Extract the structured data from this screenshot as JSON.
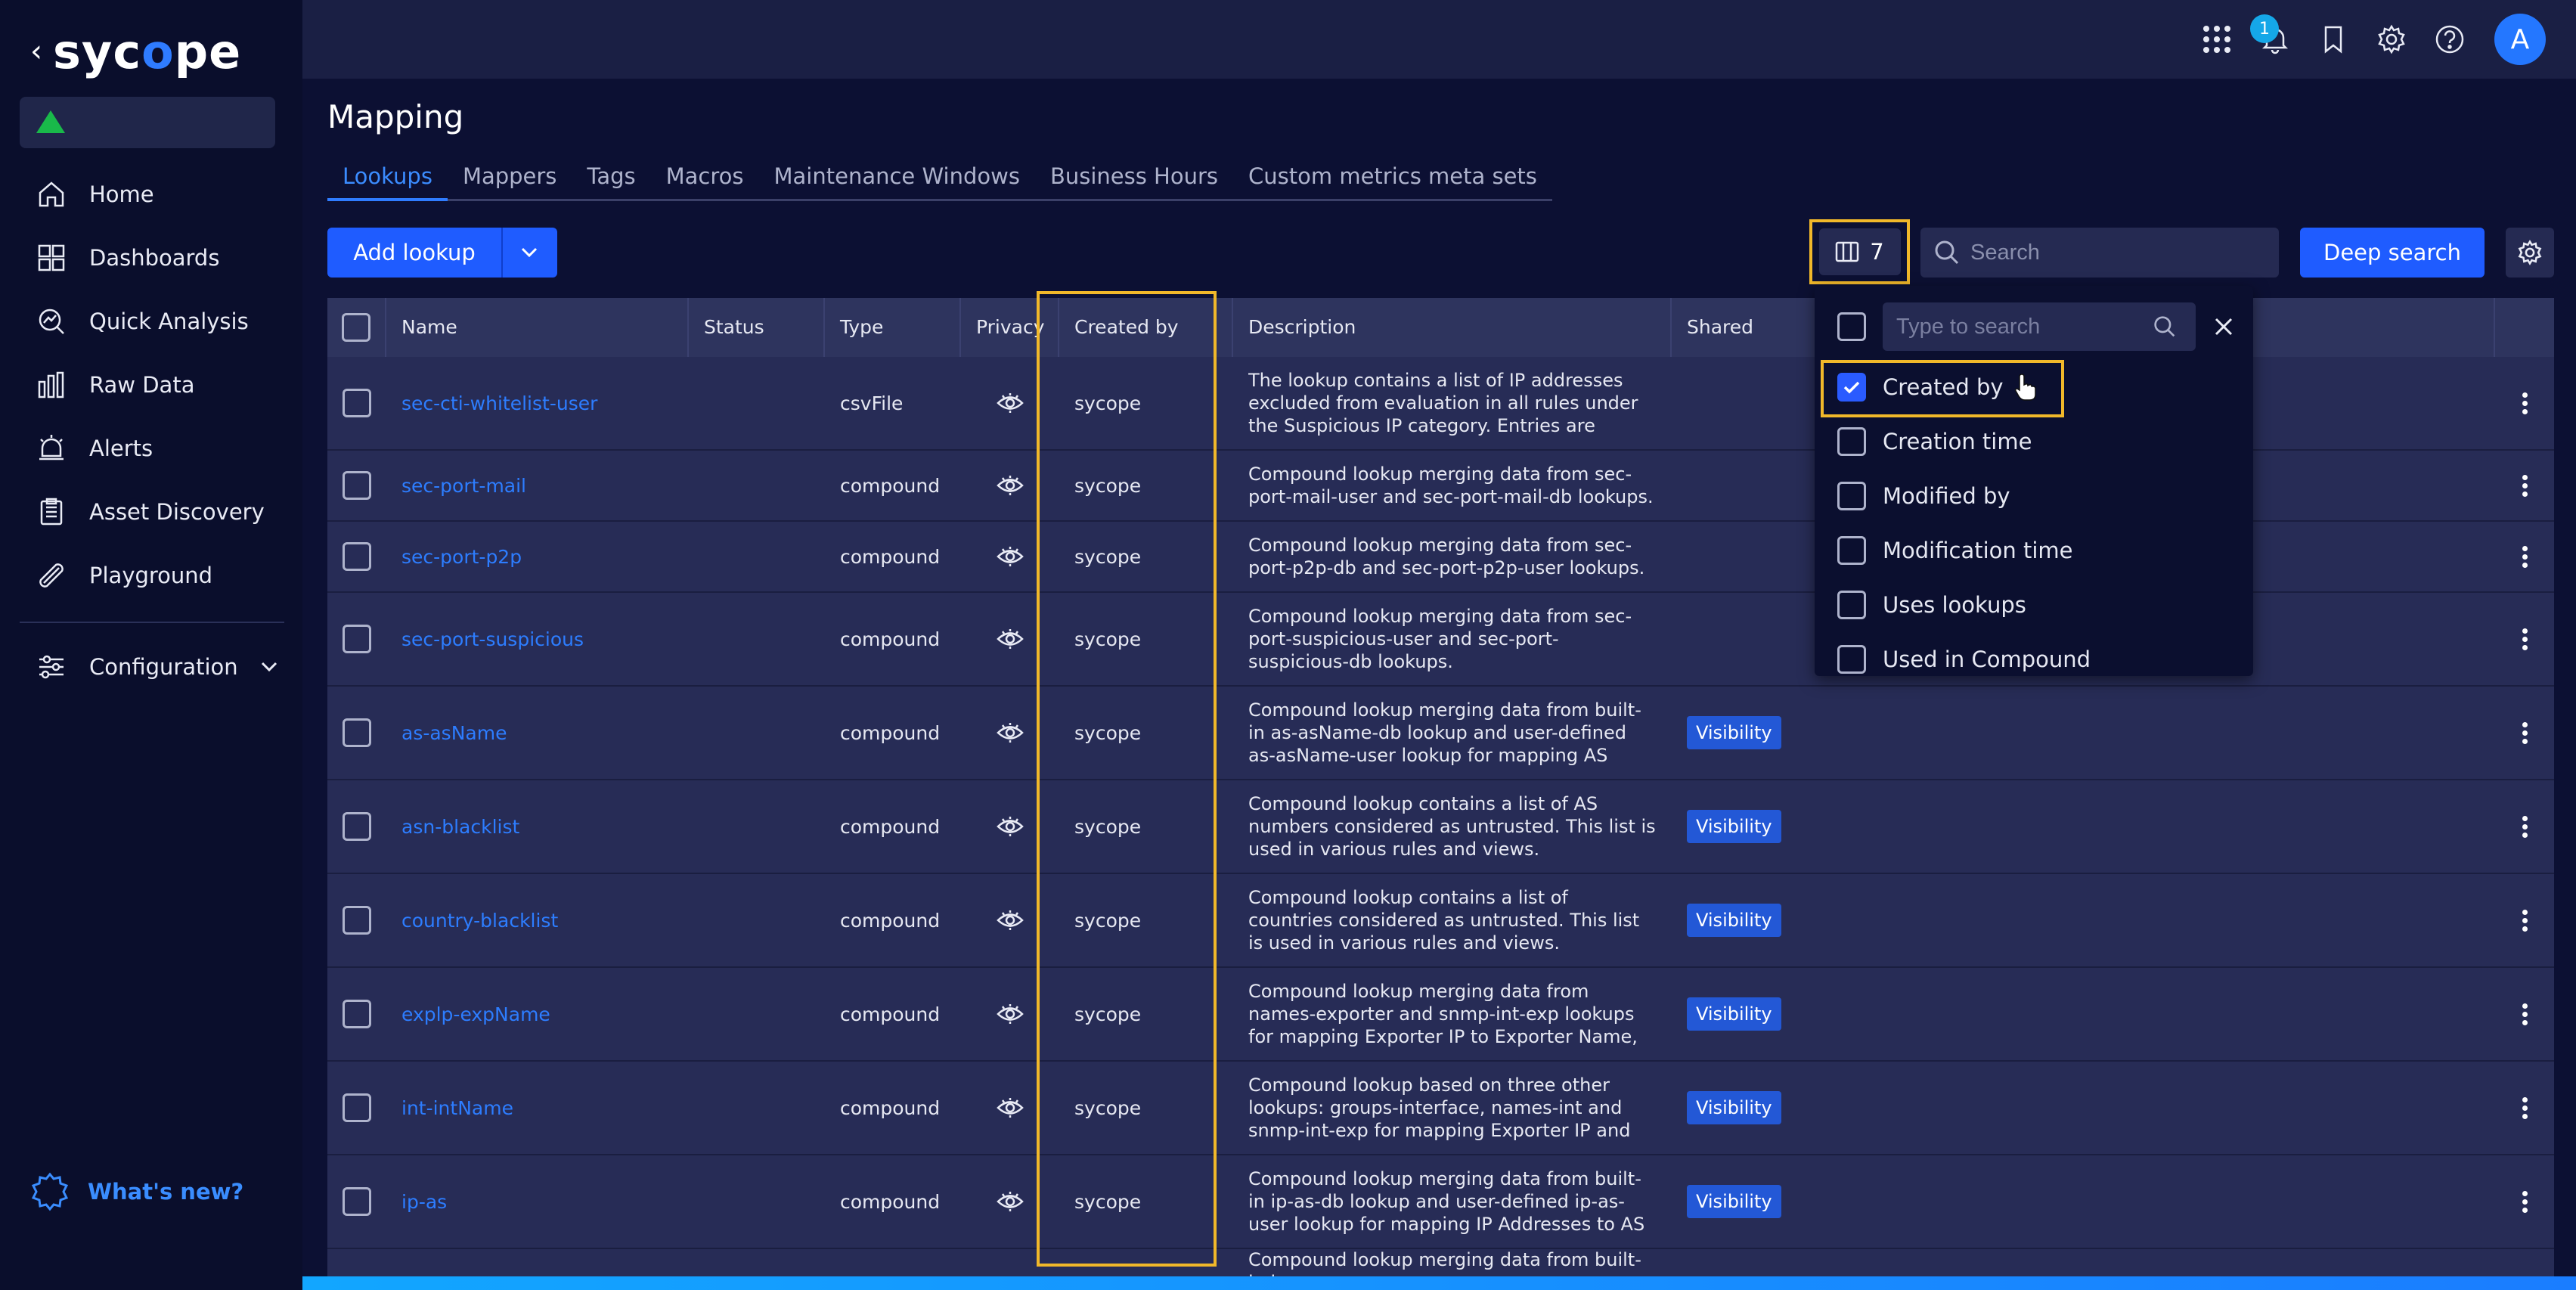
{
  "sidebar": {
    "logo": "sycope",
    "items": [
      {
        "label": "Home",
        "icon": "home-icon"
      },
      {
        "label": "Dashboards",
        "icon": "dashboards-icon"
      },
      {
        "label": "Quick Analysis",
        "icon": "quick-analysis-icon"
      },
      {
        "label": "Raw Data",
        "icon": "raw-data-icon"
      },
      {
        "label": "Alerts",
        "icon": "alerts-icon"
      },
      {
        "label": "Asset Discovery",
        "icon": "asset-discovery-icon"
      },
      {
        "label": "Playground",
        "icon": "playground-icon"
      }
    ],
    "config_label": "Configuration",
    "whats_new": "What's new?"
  },
  "topbar": {
    "notification_count": "1",
    "avatar_letter": "A"
  },
  "page": {
    "title": "Mapping",
    "tabs": [
      "Lookups",
      "Mappers",
      "Tags",
      "Macros",
      "Maintenance Windows",
      "Business Hours",
      "Custom metrics meta sets"
    ],
    "add_label": "Add lookup",
    "columns_count": "7",
    "search_placeholder": "Search",
    "deep_search_label": "Deep search"
  },
  "table": {
    "headers": [
      "Name",
      "Status",
      "Type",
      "Privacy",
      "Created by",
      "Description",
      "Shared"
    ],
    "rows": [
      {
        "name": "sec-cti-whitelist-user",
        "type": "csvFile",
        "created_by": "sycope",
        "description": "The lookup contains a list of IP addresses excluded from evaluation in all rules under the Suspicious IP category. Entries are managed and…",
        "shared": ""
      },
      {
        "name": "sec-port-mail",
        "type": "compound",
        "created_by": "sycope",
        "description": "Compound lookup merging data from sec-port-mail-user and sec-port-mail-db lookups.",
        "shared": ""
      },
      {
        "name": "sec-port-p2p",
        "type": "compound",
        "created_by": "sycope",
        "description": "Compound lookup merging data from sec-port-p2p-db and sec-port-p2p-user lookups.",
        "shared": ""
      },
      {
        "name": "sec-port-suspicious",
        "type": "compound",
        "created_by": "sycope",
        "description": "Compound lookup merging data from sec-port-suspicious-user and sec-port-suspicious-db lookups.",
        "shared": ""
      },
      {
        "name": "as-asName",
        "type": "compound",
        "created_by": "sycope",
        "description": "Compound lookup merging data from built-in as-asName-db lookup and user-defined as-asName-user lookup for mapping AS Number t…",
        "shared": "Visibility"
      },
      {
        "name": "asn-blacklist",
        "type": "compound",
        "created_by": "sycope",
        "description": "Compound lookup contains a list of AS numbers considered as untrusted. This list is used in various rules and views.",
        "shared": "Visibility"
      },
      {
        "name": "country-blacklist",
        "type": "compound",
        "created_by": "sycope",
        "description": "Compound lookup contains a list of countries considered as untrusted. This list is used in various rules and views.",
        "shared": "Visibility"
      },
      {
        "name": "explp-expName",
        "type": "compound",
        "created_by": "sycope",
        "description": "Compound lookup merging data from names-exporter and snmp-int-exp lookups for mapping Exporter IP to Exporter Name, Description,…",
        "shared": "Visibility"
      },
      {
        "name": "int-intName",
        "type": "compound",
        "created_by": "sycope",
        "description": "Compound lookup based on three other lookups: groups-interface, names-int and snmp-int-exp for mapping Exporter IP and Exporter Interface t…",
        "shared": "Visibility"
      },
      {
        "name": "ip-as",
        "type": "compound",
        "created_by": "sycope",
        "description": "Compound lookup merging data from built-in ip-as-db lookup and user-defined ip-as-user lookup for mapping IP Addresses to AS Names and AS…",
        "shared": "Visibility"
      },
      {
        "name": "",
        "type": "",
        "created_by": "",
        "description": "Compound lookup merging data from built-in ip-",
        "shared": ""
      }
    ]
  },
  "column_picker": {
    "search_placeholder": "Type to search",
    "options": [
      {
        "label": "Created by",
        "checked": true
      },
      {
        "label": "Creation time",
        "checked": false
      },
      {
        "label": "Modified by",
        "checked": false
      },
      {
        "label": "Modification time",
        "checked": false
      },
      {
        "label": "Uses lookups",
        "checked": false
      },
      {
        "label": "Used in Compound",
        "checked": false
      }
    ]
  },
  "colors": {
    "accent": "#1f5cff",
    "link": "#2d7dff",
    "highlight": "#f1b82a",
    "status_ok": "#19b94a"
  }
}
